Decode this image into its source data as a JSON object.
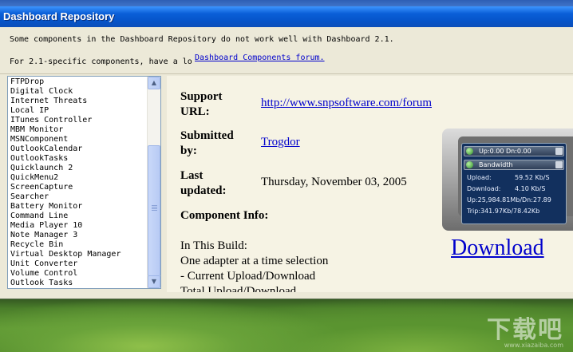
{
  "window": {
    "title": "Dashboard Repository"
  },
  "notices": {
    "line1": "Some components in the Dashboard Repository do not work well with Dashboard 2.1.",
    "line2_prefix": "For 2.1-specific components, have a lo",
    "line2_link": "Dashboard Components forum."
  },
  "component_list": [
    "FTPDrop",
    "Digital Clock",
    "Internet Threats",
    "Local IP",
    "ITunes Controller",
    "MBM Monitor",
    "MSNComponent",
    "OutlookCalendar",
    "OutlookTasks",
    "Quicklaunch 2",
    "QuickMenu2",
    "ScreenCapture",
    "Searcher",
    "Battery Monitor",
    "Command Line",
    "Media Player 10",
    "Note Manager 3",
    "Recycle Bin",
    "Virtual Desktop Manager",
    "Unit Converter",
    "Volume Control",
    "Outlook Tasks"
  ],
  "details": {
    "support_url_label_1": "Support",
    "support_url_label_2": "URL:",
    "support_url": "http://www.snpsoftware.com/forum",
    "submitted_label_1": "Submitted",
    "submitted_label_2": "by:",
    "submitted_by": "Trogdor",
    "updated_label_1": "Last",
    "updated_label_2": "updated:",
    "last_updated": "Thursday, November 03, 2005",
    "info_label": "Component Info:",
    "info_lines": [
      "In This Build:",
      "One adapter at a time selection",
      "- Current Upload/Download",
      "Total Upload/Download"
    ],
    "download_label": "Download"
  },
  "widget": {
    "row1": "Up:0.00 Dn:0.00",
    "row2": "Bandwidth",
    "upload_label": "Upload:",
    "upload_value": "59.52 Kb/S",
    "download_label": "Download:",
    "download_value": "4.10 Kb/S",
    "totals": "Up:25,984.81Mb/Dn:27.89",
    "trip": "Trip:341.97Kb/78.42Kb"
  },
  "watermark": {
    "text": "下载吧",
    "sub": "www.xiazaiba.com"
  },
  "colors": {
    "titlebar": "#0654c9",
    "link": "#0000cc",
    "panel": "#ece9d8"
  }
}
